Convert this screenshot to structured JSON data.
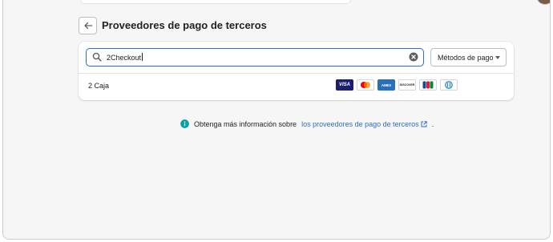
{
  "page": {
    "title": "Proveedores de pago de terceros",
    "back_label": "Volver"
  },
  "search": {
    "value": "2Checkout"
  },
  "filter": {
    "label": "Métodos de pago"
  },
  "provider": {
    "name": "2 Caja",
    "payment_methods": [
      {
        "name": "visa",
        "label": "VISA"
      },
      {
        "name": "mastercard",
        "label": ""
      },
      {
        "name": "amex",
        "label": "AMEX"
      },
      {
        "name": "discover",
        "label": "DISCOVER"
      },
      {
        "name": "jcb",
        "label": ""
      },
      {
        "name": "diners-club",
        "label": ""
      }
    ]
  },
  "footer": {
    "prefix": "Obtenga más información sobre",
    "link": "los proveedores de pago de terceros",
    "suffix": "."
  },
  "colors": {
    "accent": "#2c6ecb",
    "info_icon": "#00a0ac",
    "background": "#f6f6f7"
  },
  "icons": [
    "arrow-left-icon",
    "search-icon",
    "clear-icon",
    "chevron-down-icon",
    "info-icon",
    "external-link-icon"
  ]
}
